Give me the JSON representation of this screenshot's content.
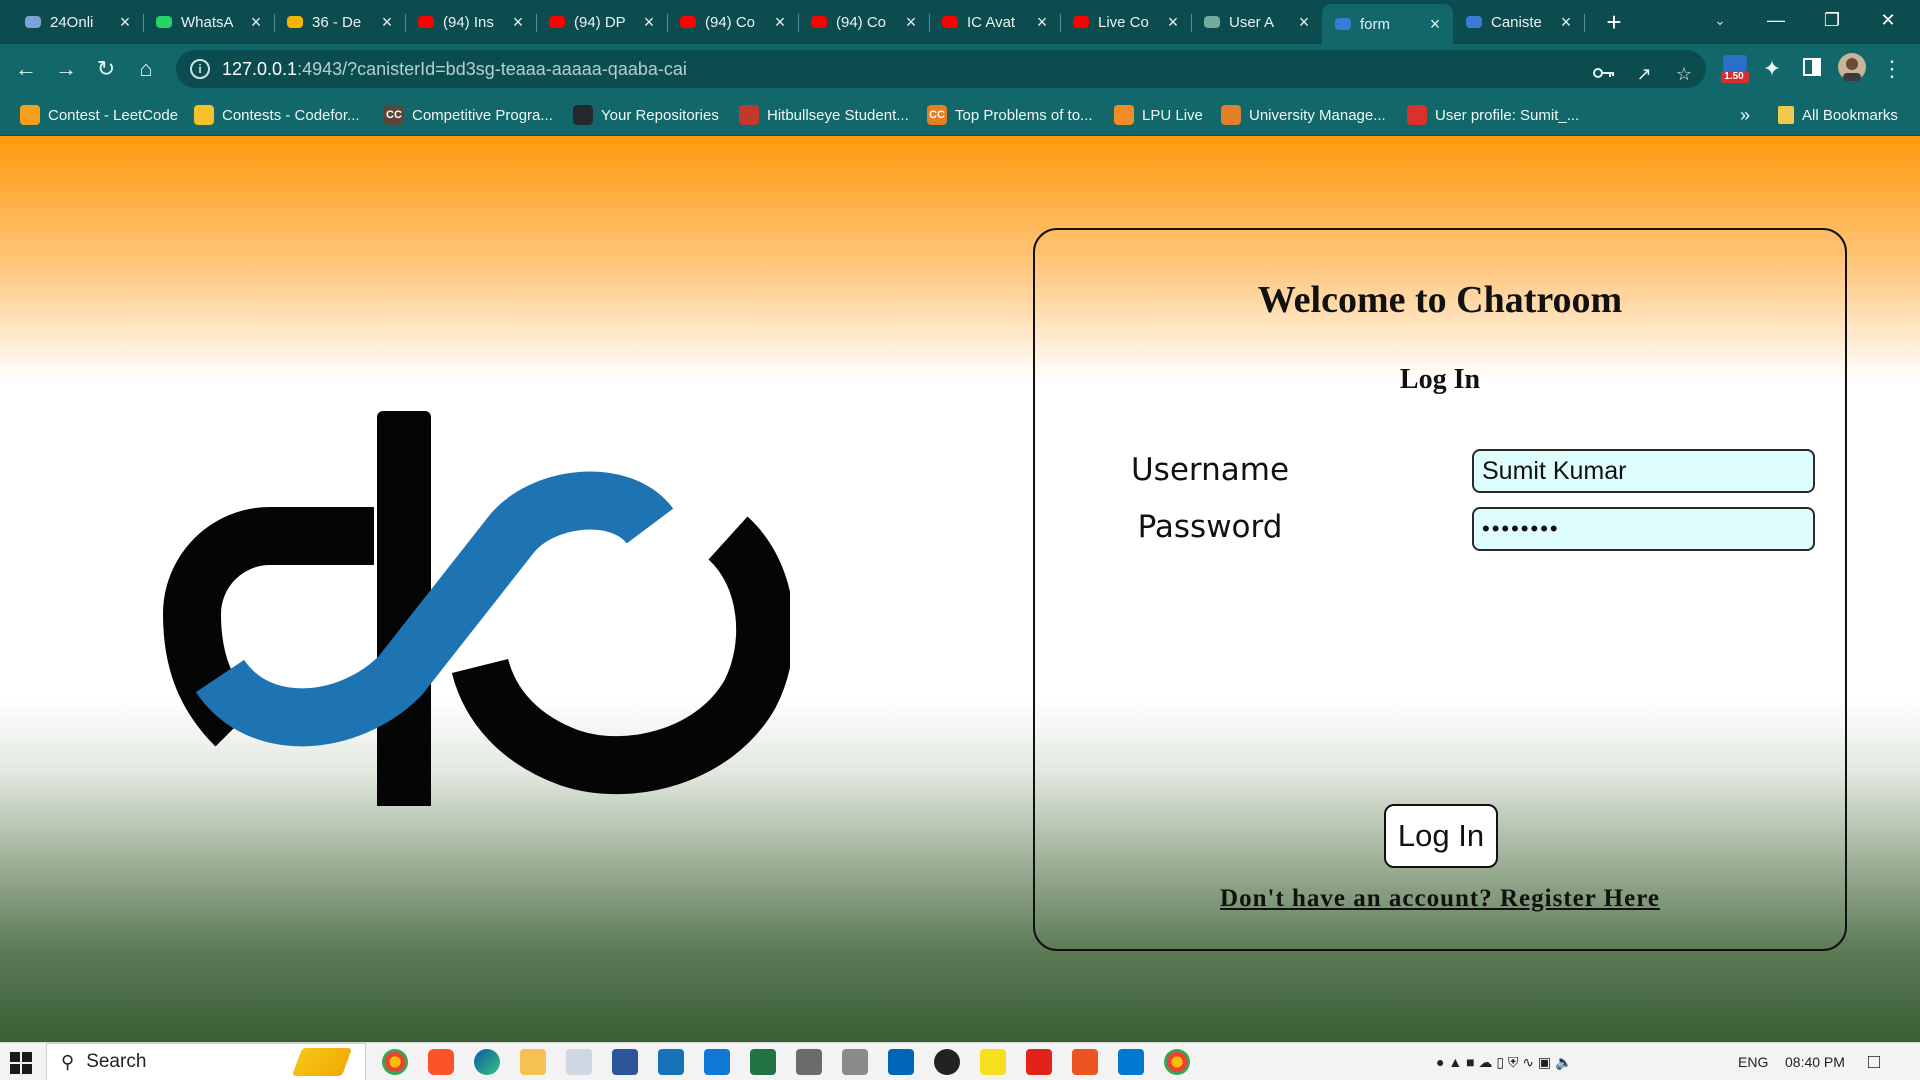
{
  "browser": {
    "tabs": [
      {
        "title": "24Onli",
        "icon": "cloud-icon",
        "color": "#7ba3d8"
      },
      {
        "title": "WhatsA",
        "icon": "whatsapp-icon",
        "color": "#25d366"
      },
      {
        "title": "36 - De",
        "icon": "drive-icon",
        "color": "#f4b400"
      },
      {
        "title": "(94) Ins",
        "icon": "youtube-icon",
        "color": "#ff0000"
      },
      {
        "title": "(94) DP",
        "icon": "youtube-icon",
        "color": "#ff0000"
      },
      {
        "title": "(94) Co",
        "icon": "youtube-icon",
        "color": "#ff0000"
      },
      {
        "title": "(94) Co",
        "icon": "youtube-icon",
        "color": "#ff0000"
      },
      {
        "title": "IC Avat",
        "icon": "youtube-icon",
        "color": "#ff0000"
      },
      {
        "title": "Live Co",
        "icon": "youtube-icon",
        "color": "#ff0000"
      },
      {
        "title": "User A",
        "icon": "openai-icon",
        "color": "#74aa9c"
      },
      {
        "title": "form",
        "icon": "infinity-icon",
        "color": "#3b7bd8"
      },
      {
        "title": "Caniste",
        "icon": "infinity-icon",
        "color": "#3b7bd8"
      }
    ],
    "active_tab": 10,
    "new_tab": "+",
    "url_host": "127.0.0.1",
    "url_rest": ":4943/?canisterId=bd3sg-teaaa-aaaaa-qaaba-cai",
    "extension_badge": "1.50",
    "bookmarks": [
      {
        "label": "Contest - LeetCode",
        "icon": "leetcode-icon",
        "color": "#f89f1b"
      },
      {
        "label": "Contests - Codefor...",
        "icon": "codeforces-icon",
        "color": "#f6c02a"
      },
      {
        "label": "Competitive Progra...",
        "icon": "codechef-icon",
        "color": "#5b4638",
        "glyph": "CC"
      },
      {
        "label": "Your Repositories",
        "icon": "github-icon",
        "color": "#24292e"
      },
      {
        "label": "Hitbullseye Student...",
        "icon": "hitbullseye-icon",
        "color": "#c0392b"
      },
      {
        "label": "Top Problems of to...",
        "icon": "codechef-orange-icon",
        "color": "#e67e22",
        "glyph": "CC"
      },
      {
        "label": "LPU Live",
        "icon": "lpu-live-icon",
        "color": "#f28c28"
      },
      {
        "label": "University Manage...",
        "icon": "university-icon",
        "color": "#e0802a"
      },
      {
        "label": "User profile: Sumit_...",
        "icon": "profile-icon",
        "color": "#d9312b"
      }
    ],
    "overflow": "»",
    "all_bookmarks": "All Bookmarks"
  },
  "page": {
    "welcome": "Welcome to Chatroom",
    "login_heading": "Log In",
    "username_label": "Username",
    "username_value": "Sumit Kumar",
    "password_label": "Password",
    "password_value": "••••••••",
    "login_button": "Log In",
    "register_link": "Don't have an account? Register Here",
    "logo_colors": {
      "dark": "#050505",
      "blue": "#1e73b3"
    }
  },
  "taskbar": {
    "search_label": "Search",
    "language": "ENG",
    "time": "08:40 PM"
  }
}
